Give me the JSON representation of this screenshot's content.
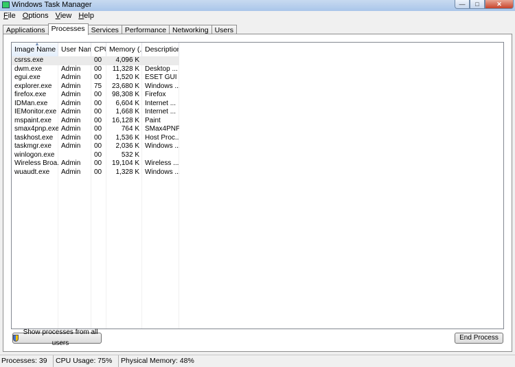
{
  "window": {
    "title": "Windows Task Manager"
  },
  "menu": [
    {
      "label": "File",
      "accel": "F",
      "rest": "ile"
    },
    {
      "label": "Options",
      "accel": "O",
      "rest": "ptions"
    },
    {
      "label": "View",
      "accel": "V",
      "rest": "iew"
    },
    {
      "label": "Help",
      "accel": "H",
      "rest": "elp"
    }
  ],
  "tabs": [
    "Applications",
    "Processes",
    "Services",
    "Performance",
    "Networking",
    "Users"
  ],
  "active_tab": "Processes",
  "columns": [
    "Image Name",
    "User Name",
    "CPU",
    "Memory (...",
    "Description"
  ],
  "processes": [
    {
      "image": "csrss.exe",
      "user": "",
      "cpu": "00",
      "memory": "4,096 K",
      "description": ""
    },
    {
      "image": "dwm.exe",
      "user": "Admin",
      "cpu": "00",
      "memory": "11,328 K",
      "description": "Desktop ..."
    },
    {
      "image": "egui.exe",
      "user": "Admin",
      "cpu": "00",
      "memory": "1,520 K",
      "description": "ESET GUI"
    },
    {
      "image": "explorer.exe",
      "user": "Admin",
      "cpu": "75",
      "memory": "23,680 K",
      "description": "Windows ..."
    },
    {
      "image": "firefox.exe",
      "user": "Admin",
      "cpu": "00",
      "memory": "98,308 K",
      "description": "Firefox"
    },
    {
      "image": "IDMan.exe",
      "user": "Admin",
      "cpu": "00",
      "memory": "6,604 K",
      "description": "Internet ..."
    },
    {
      "image": "IEMonitor.exe",
      "user": "Admin",
      "cpu": "00",
      "memory": "1,668 K",
      "description": "Internet ..."
    },
    {
      "image": "mspaint.exe",
      "user": "Admin",
      "cpu": "00",
      "memory": "16,128 K",
      "description": "Paint"
    },
    {
      "image": "smax4pnp.exe",
      "user": "Admin",
      "cpu": "00",
      "memory": "764 K",
      "description": "SMax4PNP"
    },
    {
      "image": "taskhost.exe",
      "user": "Admin",
      "cpu": "00",
      "memory": "1,536 K",
      "description": "Host Proc..."
    },
    {
      "image": "taskmgr.exe",
      "user": "Admin",
      "cpu": "00",
      "memory": "2,036 K",
      "description": "Windows ..."
    },
    {
      "image": "winlogon.exe",
      "user": "",
      "cpu": "00",
      "memory": "532 K",
      "description": ""
    },
    {
      "image": "Wireless Broa...",
      "user": "Admin",
      "cpu": "00",
      "memory": "19,104 K",
      "description": "Wireless ..."
    },
    {
      "image": "wuaudt.exe",
      "user": "Admin",
      "cpu": "00",
      "memory": "1,328 K",
      "description": "Windows ..."
    }
  ],
  "buttons": {
    "show_all": "Show processes from all users",
    "end_process": "End Process"
  },
  "status": {
    "processes": "Processes: 39",
    "cpu": "CPU Usage: 75%",
    "memory": "Physical Memory: 48%"
  }
}
